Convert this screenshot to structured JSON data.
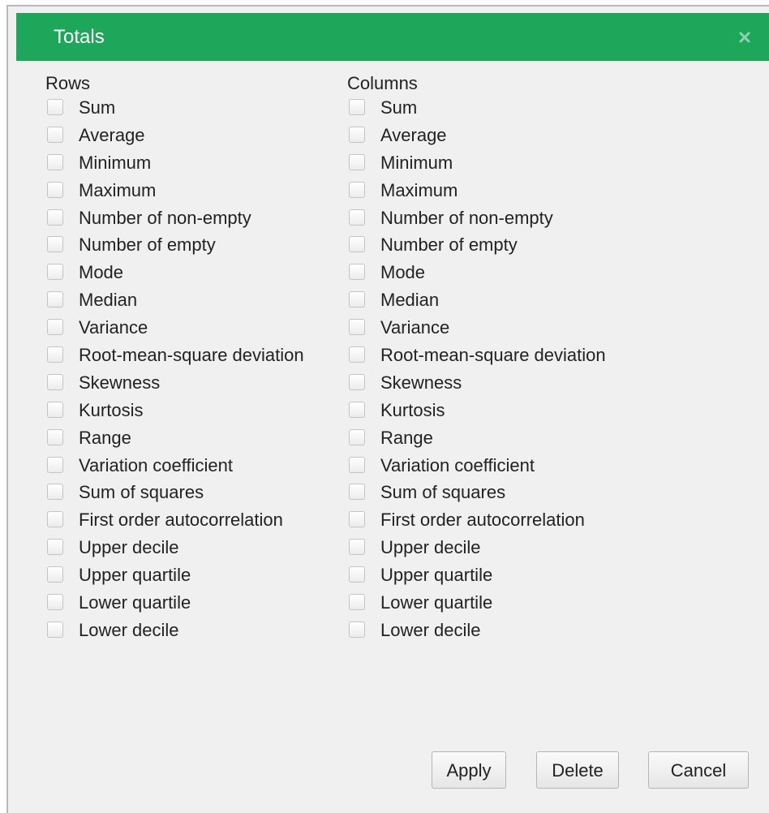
{
  "dialog": {
    "title": "Totals",
    "close_icon": "close-icon"
  },
  "rows": {
    "header": "Rows",
    "options": [
      {
        "label": "Sum",
        "checked": false
      },
      {
        "label": "Average",
        "checked": false
      },
      {
        "label": "Minimum",
        "checked": false
      },
      {
        "label": "Maximum",
        "checked": false
      },
      {
        "label": "Number of non-empty",
        "checked": false
      },
      {
        "label": "Number of empty",
        "checked": false
      },
      {
        "label": "Mode",
        "checked": false
      },
      {
        "label": "Median",
        "checked": false
      },
      {
        "label": "Variance",
        "checked": false
      },
      {
        "label": "Root-mean-square deviation",
        "checked": false
      },
      {
        "label": "Skewness",
        "checked": false
      },
      {
        "label": "Kurtosis",
        "checked": false
      },
      {
        "label": "Range",
        "checked": false
      },
      {
        "label": "Variation coefficient",
        "checked": false
      },
      {
        "label": "Sum of squares",
        "checked": false
      },
      {
        "label": "First order autocorrelation",
        "checked": false
      },
      {
        "label": "Upper decile",
        "checked": false
      },
      {
        "label": "Upper quartile",
        "checked": false
      },
      {
        "label": "Lower quartile",
        "checked": false
      },
      {
        "label": "Lower decile",
        "checked": false
      }
    ]
  },
  "columns": {
    "header": "Columns",
    "options": [
      {
        "label": "Sum",
        "checked": false
      },
      {
        "label": "Average",
        "checked": false
      },
      {
        "label": "Minimum",
        "checked": false
      },
      {
        "label": "Maximum",
        "checked": false
      },
      {
        "label": "Number of non-empty",
        "checked": false
      },
      {
        "label": "Number of empty",
        "checked": false
      },
      {
        "label": "Mode",
        "checked": false
      },
      {
        "label": "Median",
        "checked": false
      },
      {
        "label": "Variance",
        "checked": false
      },
      {
        "label": "Root-mean-square deviation",
        "checked": false
      },
      {
        "label": "Skewness",
        "checked": false
      },
      {
        "label": "Kurtosis",
        "checked": false
      },
      {
        "label": "Range",
        "checked": false
      },
      {
        "label": "Variation coefficient",
        "checked": false
      },
      {
        "label": "Sum of squares",
        "checked": false
      },
      {
        "label": "First order autocorrelation",
        "checked": false
      },
      {
        "label": "Upper decile",
        "checked": false
      },
      {
        "label": "Upper quartile",
        "checked": false
      },
      {
        "label": "Lower quartile",
        "checked": false
      },
      {
        "label": "Lower decile",
        "checked": false
      }
    ]
  },
  "buttons": {
    "apply": "Apply",
    "delete": "Delete",
    "cancel": "Cancel"
  },
  "colors": {
    "titlebar": "#1ea65b",
    "dialog_background": "#f0f0f0"
  }
}
